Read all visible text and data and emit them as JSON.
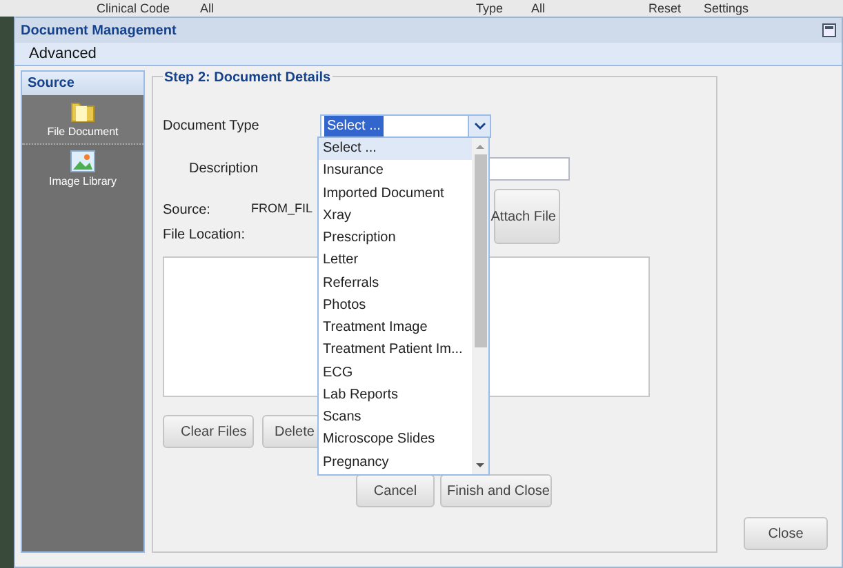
{
  "background_bar": {
    "texts": [
      "Clinical Code",
      "All",
      "Type",
      "All",
      "Reset",
      "Settings"
    ]
  },
  "window": {
    "title": "Document Management"
  },
  "menu": [
    "Advanced"
  ],
  "sidebar": {
    "header": "Source",
    "items": [
      {
        "label": "File Document",
        "kind": "folder",
        "selected": true
      },
      {
        "label": "Image Library",
        "kind": "image",
        "selected": false
      }
    ]
  },
  "step": {
    "title": "Step 2: Document Details",
    "document_type": {
      "label": "Document Type",
      "value": "Select ..."
    },
    "description": {
      "label": "Description"
    },
    "source": {
      "label": "Source:",
      "value": "FROM_FIL"
    },
    "file_location": {
      "label": "File Location:"
    },
    "attach_button": "Attach File",
    "buttons": [
      "Clear Files",
      "Delete"
    ],
    "footer_buttons": [
      "Cancel",
      "Finish and Close"
    ]
  },
  "dropdown": {
    "options": [
      {
        "label": "Select ...",
        "selected": true
      },
      {
        "label": "Insurance",
        "selected": false
      },
      {
        "label": "Imported Document",
        "selected": false
      },
      {
        "label": "Xray",
        "selected": false
      },
      {
        "label": "Prescription",
        "selected": false
      },
      {
        "label": "Letter",
        "selected": false
      },
      {
        "label": "Referrals",
        "selected": false
      },
      {
        "label": "Photos",
        "selected": false
      },
      {
        "label": "Treatment Image",
        "selected": false
      },
      {
        "label": "Treatment Patient Im...",
        "selected": false
      },
      {
        "label": "ECG",
        "selected": false
      },
      {
        "label": "Lab Reports",
        "selected": false
      },
      {
        "label": "Scans",
        "selected": false
      },
      {
        "label": "Microscope Slides",
        "selected": false
      },
      {
        "label": "Pregnancy",
        "selected": false
      }
    ]
  },
  "close_button": "Close"
}
